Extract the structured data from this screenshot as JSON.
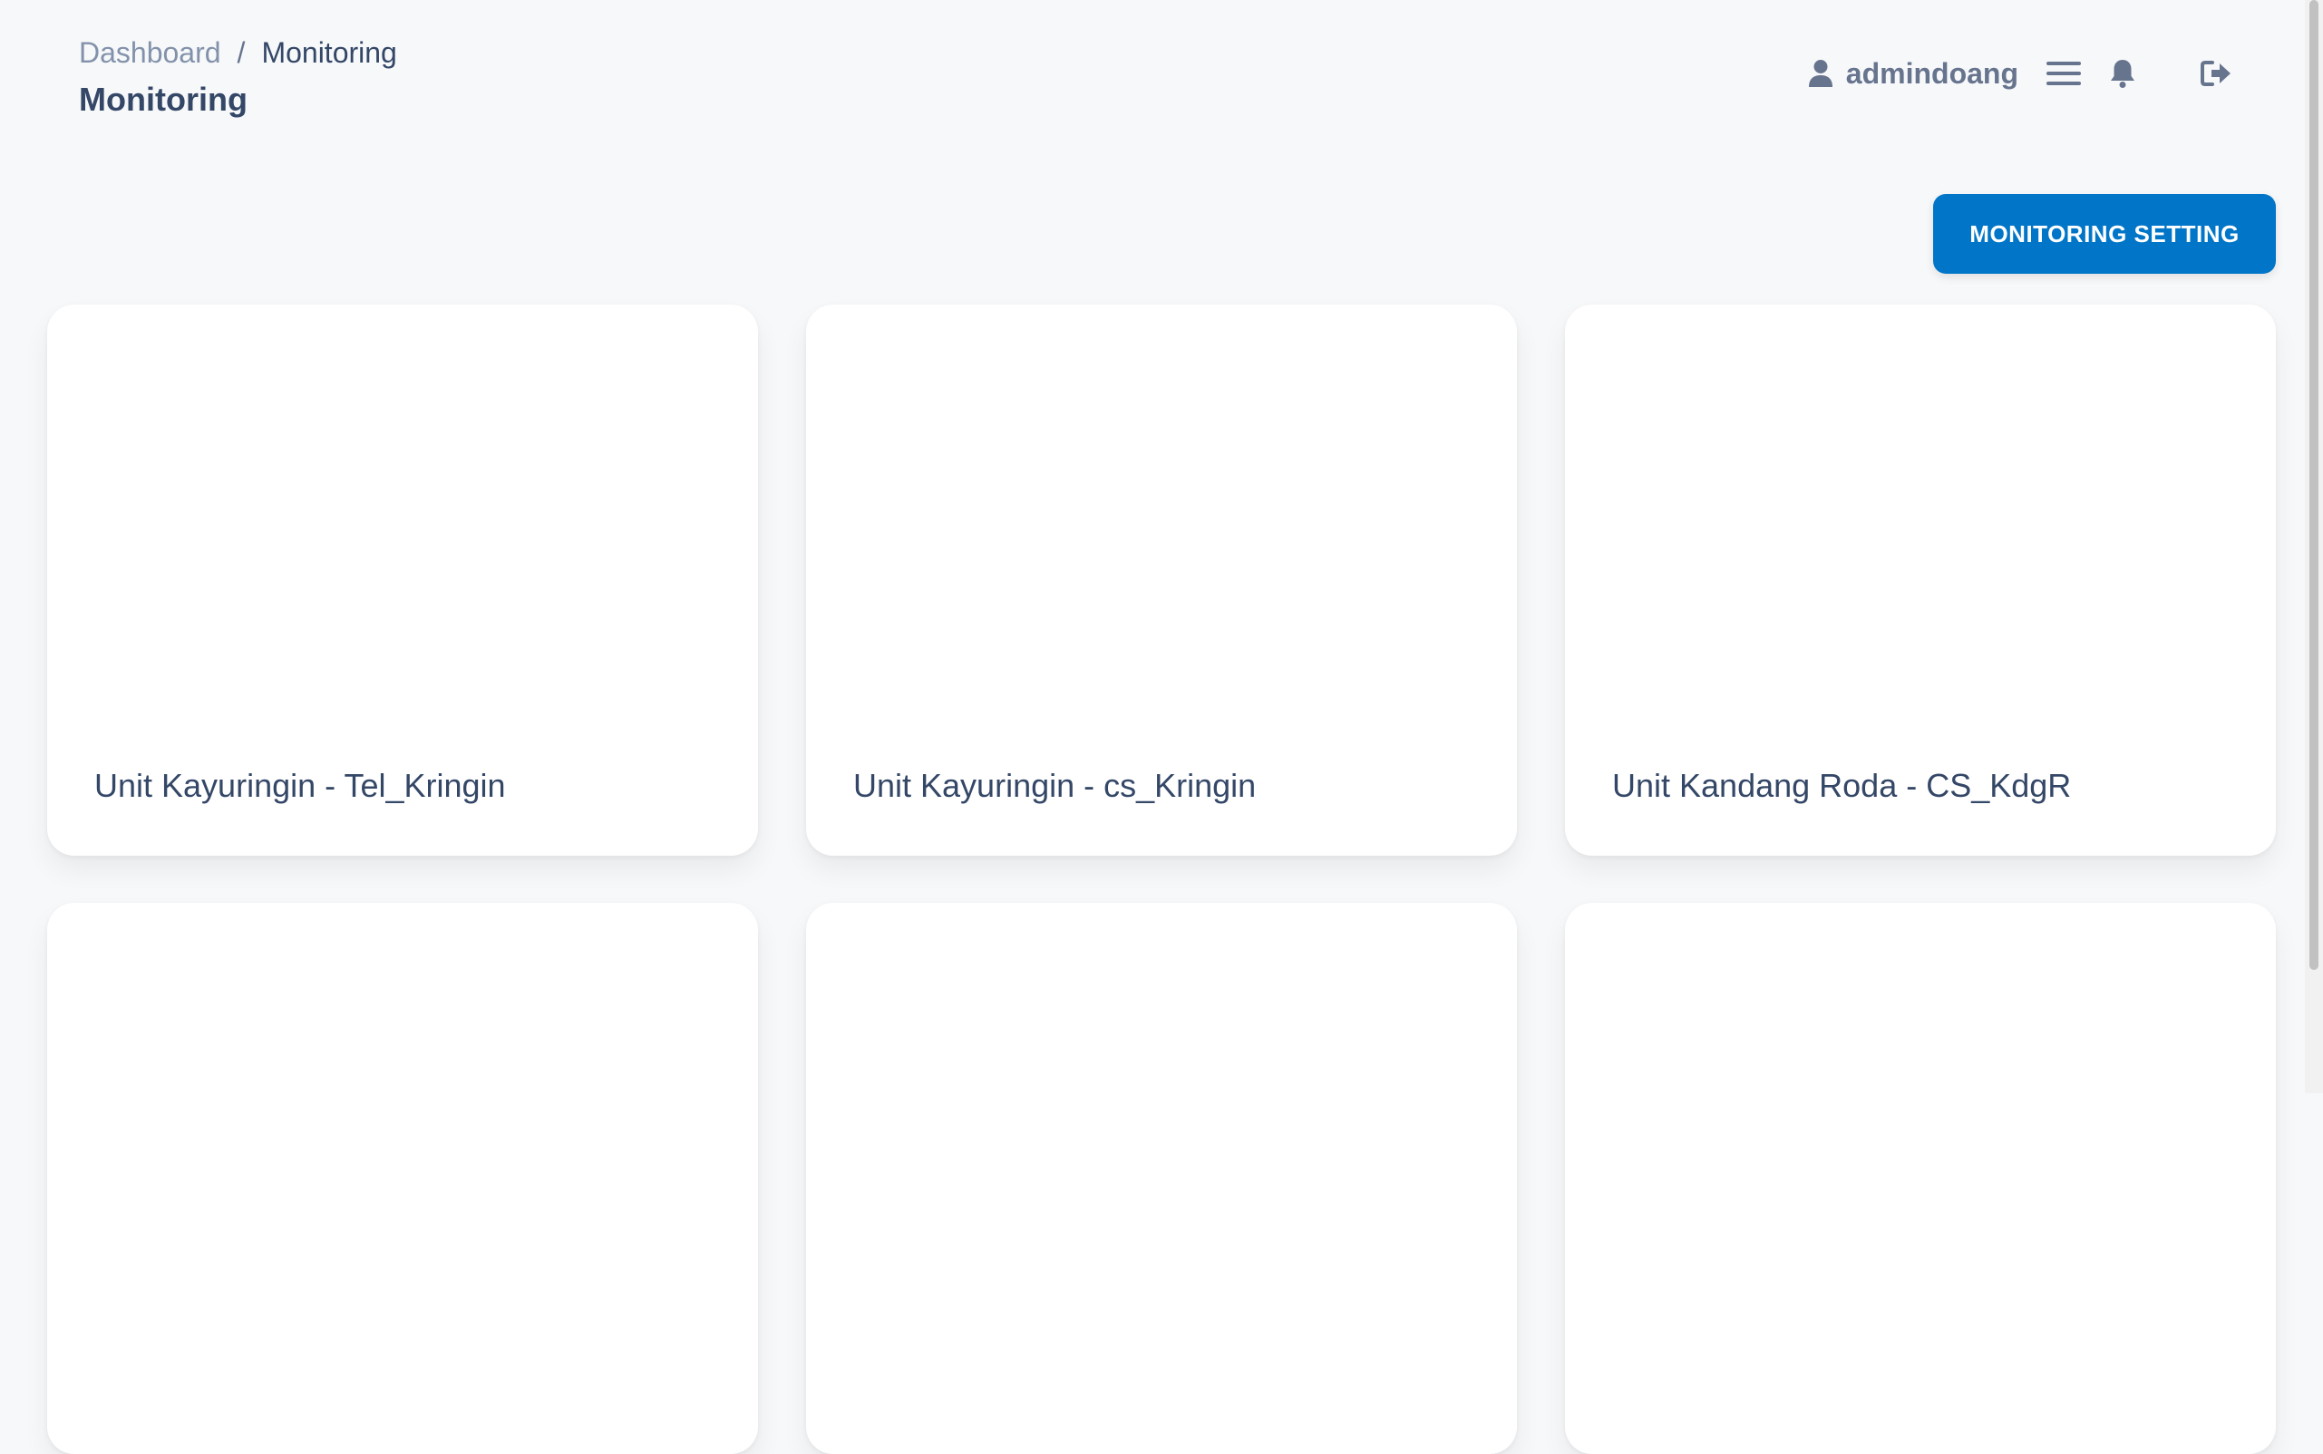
{
  "breadcrumb": {
    "parent": "Dashboard",
    "separator": "/",
    "current": "Monitoring"
  },
  "page": {
    "title": "Monitoring"
  },
  "topbar": {
    "username": "admindoang",
    "icons": [
      "user-icon",
      "menu-icon",
      "bell-icon",
      "sign-out-icon"
    ]
  },
  "actions": {
    "monitoring_setting_label": "MONITORING SETTING"
  },
  "cards": [
    {
      "label": "Unit Kayuringin - Tel_Kringin"
    },
    {
      "label": "Unit Kayuringin - cs_Kringin"
    },
    {
      "label": "Unit Kandang Roda - CS_KdgR"
    },
    {
      "label": ""
    },
    {
      "label": ""
    },
    {
      "label": ""
    }
  ],
  "colors": {
    "background": "#f7f8fa",
    "primary_button": "#0175c8",
    "text_dark": "#344767",
    "text_muted": "#8392ab",
    "card": "#ffffff"
  }
}
